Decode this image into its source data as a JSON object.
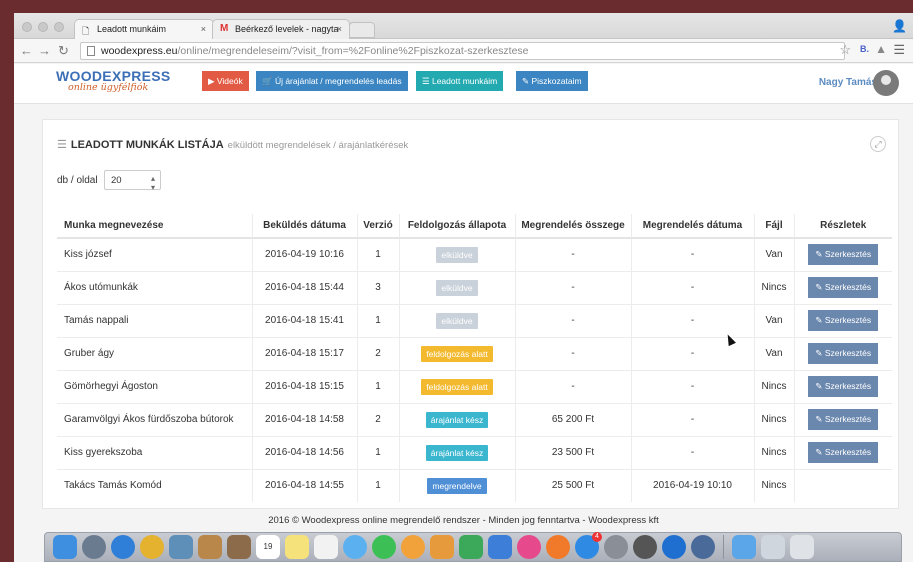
{
  "browser": {
    "tabs": [
      {
        "title": "Leadott munkáim",
        "close": "×"
      },
      {
        "title": "Beérkező levelek - nagyta",
        "close": "×"
      }
    ],
    "url_host": "woodexpress.eu",
    "url_path": "/online/megrendeleseim/?visit_from=%2Fonline%2Fpiszkozat-szerkesztese",
    "ext_label": "B."
  },
  "header": {
    "logo_main": "WOODEXPRESS",
    "logo_sub": "online ügyfélfiók",
    "buttons": [
      {
        "label": "▶ Videók",
        "color": "#e25a44"
      },
      {
        "label": "🛒 Új árajánlat / megrendelés leadás",
        "color": "#3a85c2"
      },
      {
        "label": "☰ Leadott munkáim",
        "color": "#22aab0"
      },
      {
        "label": "✎ Piszkozataim",
        "color": "#3a85c2"
      }
    ],
    "user_name": "Nagy Tamás"
  },
  "panel": {
    "title": "LEADOTT MUNKÁK LISTÁJA",
    "subtitle": "elküldött megrendelések / árajánlatkérések",
    "per_page_label": "db / oldal",
    "per_page_value": "20"
  },
  "table": {
    "headers": [
      "Munka megnevezése",
      "Beküldés dátuma",
      "Verzió",
      "Feldolgozás állapota",
      "Megrendelés összege",
      "Megrendelés dátuma",
      "Fájl",
      "Részletek"
    ],
    "edit_label": "✎ Szerkesztés",
    "rows": [
      {
        "name": "Kiss józsef",
        "date": "2016-04-19 10:16",
        "version": "1",
        "status": "elküldve",
        "status_color": "#c9d1da",
        "amount": "-",
        "order_date": "-",
        "file": "Van"
      },
      {
        "name": "Ákos utómunkák",
        "date": "2016-04-18 15:44",
        "version": "3",
        "status": "elküldve",
        "status_color": "#c9d1da",
        "amount": "-",
        "order_date": "-",
        "file": "Nincs"
      },
      {
        "name": "Tamás nappali",
        "date": "2016-04-18 15:41",
        "version": "1",
        "status": "elküldve",
        "status_color": "#c9d1da",
        "amount": "-",
        "order_date": "-",
        "file": "Van"
      },
      {
        "name": "Gruber ágy",
        "date": "2016-04-18 15:17",
        "version": "2",
        "status": "feldolgozás alatt",
        "status_color": "#f3b92f",
        "amount": "-",
        "order_date": "-",
        "file": "Van"
      },
      {
        "name": "Gömörhegyi Ágoston",
        "date": "2016-04-18 15:15",
        "version": "1",
        "status": "feldolgozás alatt",
        "status_color": "#f3b92f",
        "amount": "-",
        "order_date": "-",
        "file": "Nincs"
      },
      {
        "name": "Garamvölgyi Ákos fürdőszoba bútorok",
        "date": "2016-04-18 14:58",
        "version": "2",
        "status": "árajánlat kész",
        "status_color": "#3bb6cf",
        "amount": "65 200 Ft",
        "order_date": "-",
        "file": "Nincs"
      },
      {
        "name": "Kiss gyerekszoba",
        "date": "2016-04-18 14:56",
        "version": "1",
        "status": "árajánlat kész",
        "status_color": "#3bb6cf",
        "amount": "23 500 Ft",
        "order_date": "-",
        "file": "Nincs"
      },
      {
        "name": "Takács Tamás Komód",
        "date": "2016-04-18 14:55",
        "version": "1",
        "status": "megrendelve",
        "status_color": "#4f8fd6",
        "amount": "25 500 Ft",
        "order_date": "2016-04-19 10:10",
        "file": "Nincs"
      }
    ]
  },
  "footer": {
    "text": "2016 © Woodexpress online megrendelő rendszer - Minden jog fenntartva - Woodexpress kft"
  },
  "dock": {
    "icons": [
      {
        "name": "finder-icon",
        "color": "#3f8fe0"
      },
      {
        "name": "launchpad-icon",
        "color": "#6b7b8f"
      },
      {
        "name": "safari-icon",
        "color": "#2f7fd8"
      },
      {
        "name": "chrome-icon",
        "color": "#e4b22f"
      },
      {
        "name": "preview-icon",
        "color": "#5e8fb8"
      },
      {
        "name": "notes-book-icon",
        "color": "#b9874a"
      },
      {
        "name": "contacts-icon",
        "color": "#8b6b4a"
      },
      {
        "name": "calendar-icon",
        "color": "#ffffff",
        "label": "19"
      },
      {
        "name": "notes-icon",
        "color": "#f6e27a"
      },
      {
        "name": "reminders-icon",
        "color": "#f2f2f2"
      },
      {
        "name": "messages-icon",
        "color": "#5bb1f0"
      },
      {
        "name": "facetime-icon",
        "color": "#3cbf55"
      },
      {
        "name": "photos-icon",
        "color": "#f2a23a"
      },
      {
        "name": "pages-icon",
        "color": "#e79a3b"
      },
      {
        "name": "numbers-icon",
        "color": "#3ca85a"
      },
      {
        "name": "keynote-icon",
        "color": "#3d7fd8"
      },
      {
        "name": "itunes-icon",
        "color": "#e64a8d"
      },
      {
        "name": "ibooks-icon",
        "color": "#f07a2a"
      },
      {
        "name": "app-store-icon",
        "color": "#2f8ae4",
        "badge": "4"
      },
      {
        "name": "system-preferences-icon",
        "color": "#8a8f97"
      },
      {
        "name": "github-icon",
        "color": "#555555"
      },
      {
        "name": "teamviewer-icon",
        "color": "#1f6fd0"
      },
      {
        "name": "quicktime-icon",
        "color": "#4a6a9a"
      },
      {
        "name": "downloads-folder-icon",
        "color": "#5aa6e8"
      },
      {
        "name": "screenshot-folder-icon",
        "color": "#cfd6de"
      },
      {
        "name": "trash-icon",
        "color": "#dfe3e8"
      }
    ]
  }
}
